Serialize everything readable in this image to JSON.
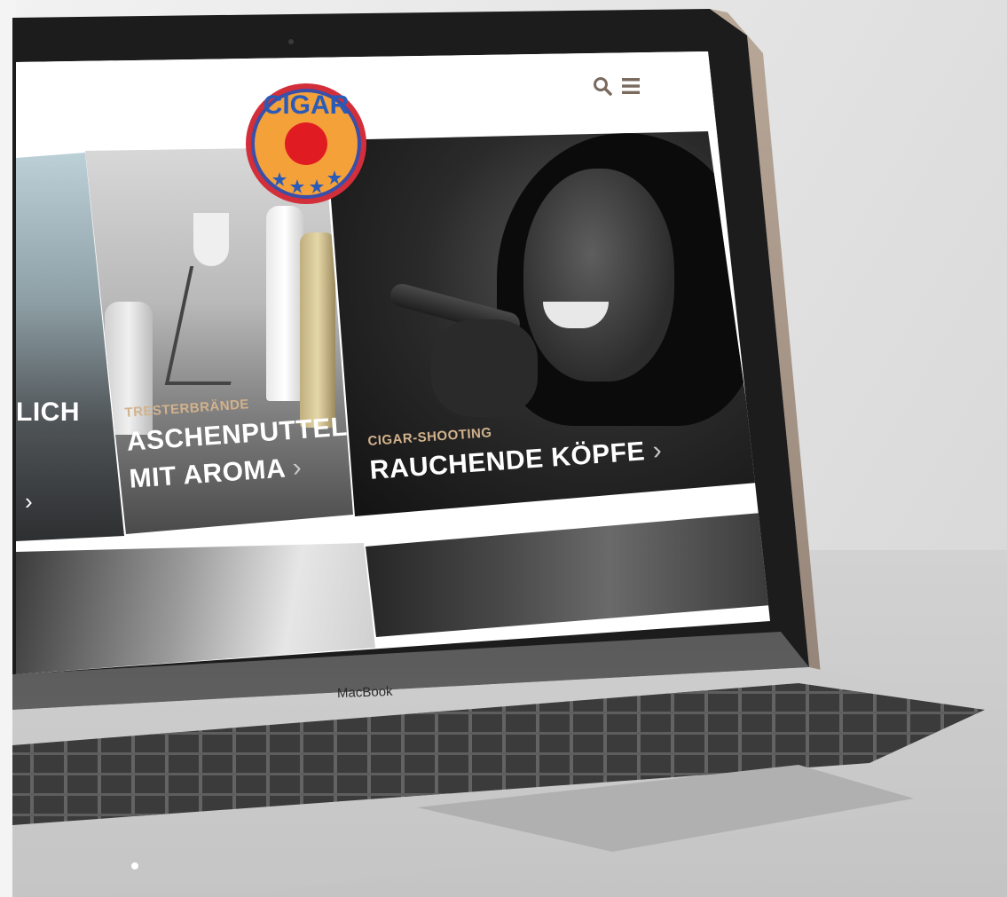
{
  "header": {
    "logo_text": "CIGAR",
    "search_icon": "search-icon",
    "menu_icon": "hamburger-menu-icon"
  },
  "tiles": [
    {
      "kicker": "",
      "headline": "LICH",
      "chevron": "›"
    },
    {
      "kicker": "TRESTERBRÄNDE",
      "headline_line1": "ASCHENPUTTEL",
      "headline_line2": "MIT AROMA",
      "chevron": "›"
    },
    {
      "kicker": "CIGAR-SHOOTING",
      "headline": "RAUCHENDE KÖPFE",
      "chevron": "›"
    }
  ],
  "device": {
    "label": "MacBook"
  },
  "colors": {
    "accent_kicker": "#d2b28c",
    "header_icons": "#7a6a5e",
    "badge_orange": "#f4a13a",
    "badge_blue": "#2a5bb8",
    "badge_red": "#e11b22"
  }
}
